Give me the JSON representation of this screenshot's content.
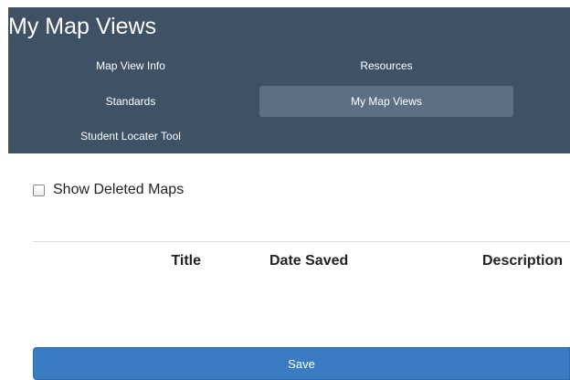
{
  "header": {
    "title": "My Map Views",
    "nav": {
      "map_view_info": "Map View Info",
      "resources": "Resources",
      "standards": "Standards",
      "my_map_views": "My Map Views",
      "student_locater_tool": "Student Locater Tool",
      "active": "My Map Views"
    }
  },
  "filters": {
    "show_deleted_label": "Show Deleted Maps",
    "show_deleted_checked": false
  },
  "table": {
    "columns": [
      "Title",
      "Date Saved",
      "Description"
    ],
    "rows": []
  },
  "actions": {
    "save_label": "Save"
  },
  "colors": {
    "header_bg": "#3f5164",
    "active_tab_bg": "#5d7083",
    "primary_button": "#3a7cc1"
  }
}
